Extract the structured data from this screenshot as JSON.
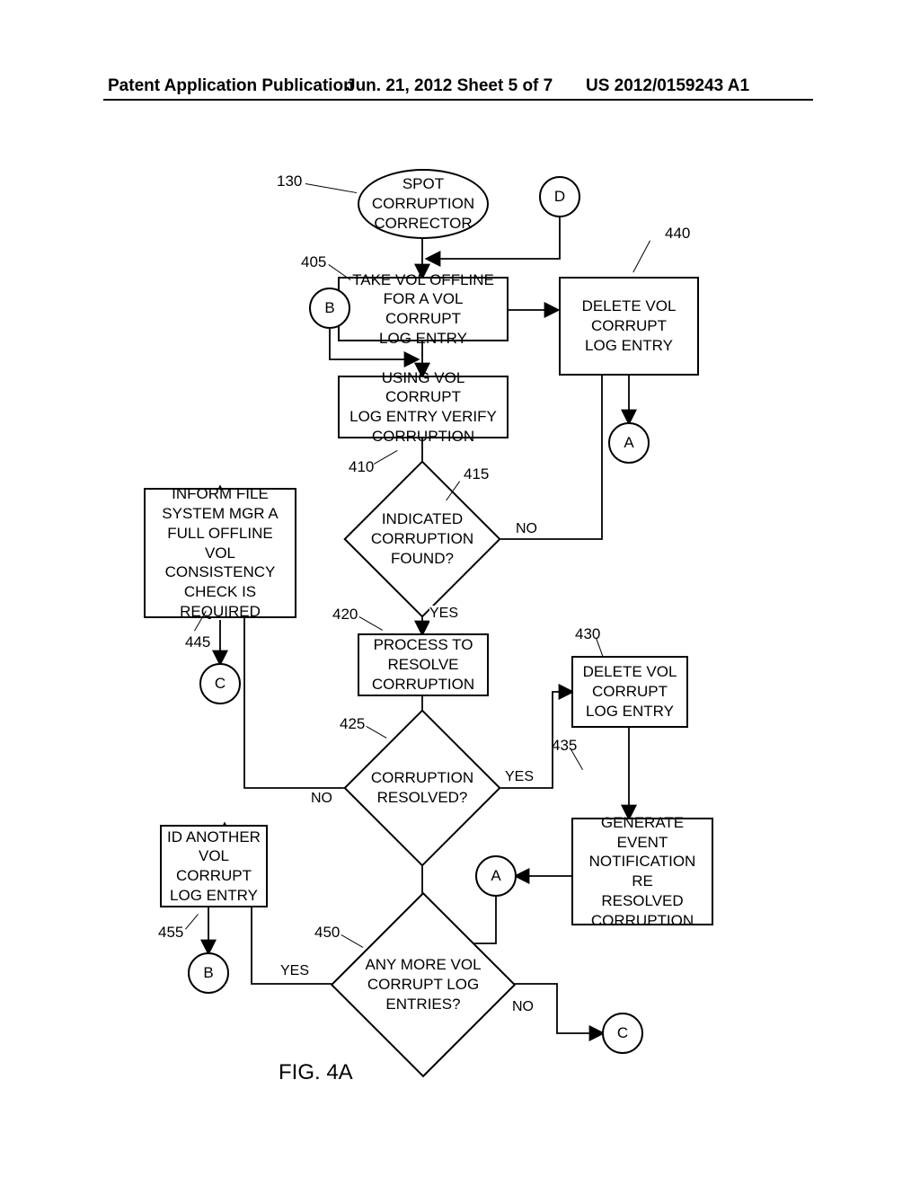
{
  "header": {
    "left": "Patent Application Publication",
    "center": "Jun. 21, 2012  Sheet 5 of 7",
    "right": "US 2012/0159243 A1"
  },
  "figure_label": "FIG. 4A",
  "refs": {
    "r130": "130",
    "r405": "405",
    "r410": "410",
    "r415": "415",
    "r420": "420",
    "r425": "425",
    "r430": "430",
    "r435": "435",
    "r440": "440",
    "r445": "445",
    "r450": "450",
    "r455": "455"
  },
  "connectors": {
    "A": "A",
    "B": "B",
    "C": "C",
    "D": "D"
  },
  "nodes": {
    "start": "SPOT\nCORRUPTION\nCORRECTOR",
    "n405": "TAKE VOL OFFLINE\nFOR A VOL CORRUPT\nLOG ENTRY",
    "n410": "USING VOL CORRUPT\nLOG ENTRY VERIFY\nCORRUPTION",
    "d415": "INDICATED\nCORRUPTION\nFOUND?",
    "n420": "PROCESS TO\nRESOLVE\nCORRUPTION",
    "d425": "CORRUPTION\nRESOLVED?",
    "n430": "DELETE VOL\nCORRUPT\nLOG ENTRY",
    "n435": "GENERATE\nEVENT\nNOTIFICATION RE\nRESOLVED\nCORRUPTION",
    "n440": "DELETE VOL\nCORRUPT\nLOG ENTRY",
    "n445": "INFORM FILE\nSYSTEM MGR A\nFULL OFFLINE VOL\nCONSISTENCY\nCHECK IS\nREQUIRED",
    "d450": "ANY MORE VOL\nCORRUPT LOG\nENTRIES?",
    "n455": "ID ANOTHER\nVOL\nCORRUPT\nLOG ENTRY"
  },
  "edge_labels": {
    "yes415": "YES",
    "no415": "NO",
    "yes425": "YES",
    "no425": "NO",
    "yes450": "YES",
    "no450": "NO"
  },
  "chart_data": {
    "type": "flowchart",
    "title": "FIG. 4A — Spot Corruption Corrector",
    "nodes": [
      {
        "id": "130",
        "type": "terminator",
        "label": "SPOT CORRUPTION CORRECTOR"
      },
      {
        "id": "D_in",
        "type": "connector",
        "label": "D"
      },
      {
        "id": "405",
        "type": "process",
        "label": "TAKE VOL OFFLINE FOR A VOL CORRUPT LOG ENTRY"
      },
      {
        "id": "B_in",
        "type": "connector",
        "label": "B"
      },
      {
        "id": "410",
        "type": "process",
        "label": "USING VOL CORRUPT LOG ENTRY VERIFY CORRUPTION"
      },
      {
        "id": "415",
        "type": "decision",
        "label": "INDICATED CORRUPTION FOUND?"
      },
      {
        "id": "440",
        "type": "process",
        "label": "DELETE VOL CORRUPT LOG ENTRY"
      },
      {
        "id": "A_out1",
        "type": "connector",
        "label": "A"
      },
      {
        "id": "420",
        "type": "process",
        "label": "PROCESS TO RESOLVE CORRUPTION"
      },
      {
        "id": "425",
        "type": "decision",
        "label": "CORRUPTION RESOLVED?"
      },
      {
        "id": "430",
        "type": "process",
        "label": "DELETE VOL CORRUPT LOG ENTRY"
      },
      {
        "id": "435",
        "type": "process",
        "label": "GENERATE EVENT NOTIFICATION RE RESOLVED CORRUPTION"
      },
      {
        "id": "A_in",
        "type": "connector",
        "label": "A"
      },
      {
        "id": "445",
        "type": "process",
        "label": "INFORM FILE SYSTEM MGR A FULL OFFLINE VOL CONSISTENCY CHECK IS REQUIRED"
      },
      {
        "id": "C_out1",
        "type": "connector",
        "label": "C"
      },
      {
        "id": "450",
        "type": "decision",
        "label": "ANY MORE VOL CORRUPT LOG ENTRIES?"
      },
      {
        "id": "455",
        "type": "process",
        "label": "ID ANOTHER VOL CORRUPT LOG ENTRY"
      },
      {
        "id": "B_out",
        "type": "connector",
        "label": "B"
      },
      {
        "id": "C_out2",
        "type": "connector",
        "label": "C"
      }
    ],
    "edges": [
      {
        "from": "130",
        "to": "405"
      },
      {
        "from": "D_in",
        "to": "405"
      },
      {
        "from": "405",
        "to": "410"
      },
      {
        "from": "B_in",
        "to": "410"
      },
      {
        "from": "410",
        "to": "415"
      },
      {
        "from": "415",
        "to": "420",
        "label": "YES"
      },
      {
        "from": "415",
        "to": "440",
        "label": "NO"
      },
      {
        "from": "440",
        "to": "A_out1"
      },
      {
        "from": "420",
        "to": "425"
      },
      {
        "from": "425",
        "to": "430",
        "label": "YES"
      },
      {
        "from": "425",
        "to": "445",
        "label": "NO"
      },
      {
        "from": "430",
        "to": "435"
      },
      {
        "from": "435",
        "to": "A_in"
      },
      {
        "from": "A_in",
        "to": "450"
      },
      {
        "from": "445",
        "to": "C_out1"
      },
      {
        "from": "450",
        "to": "455",
        "label": "YES"
      },
      {
        "from": "450",
        "to": "C_out2",
        "label": "NO"
      },
      {
        "from": "455",
        "to": "B_out"
      }
    ]
  }
}
